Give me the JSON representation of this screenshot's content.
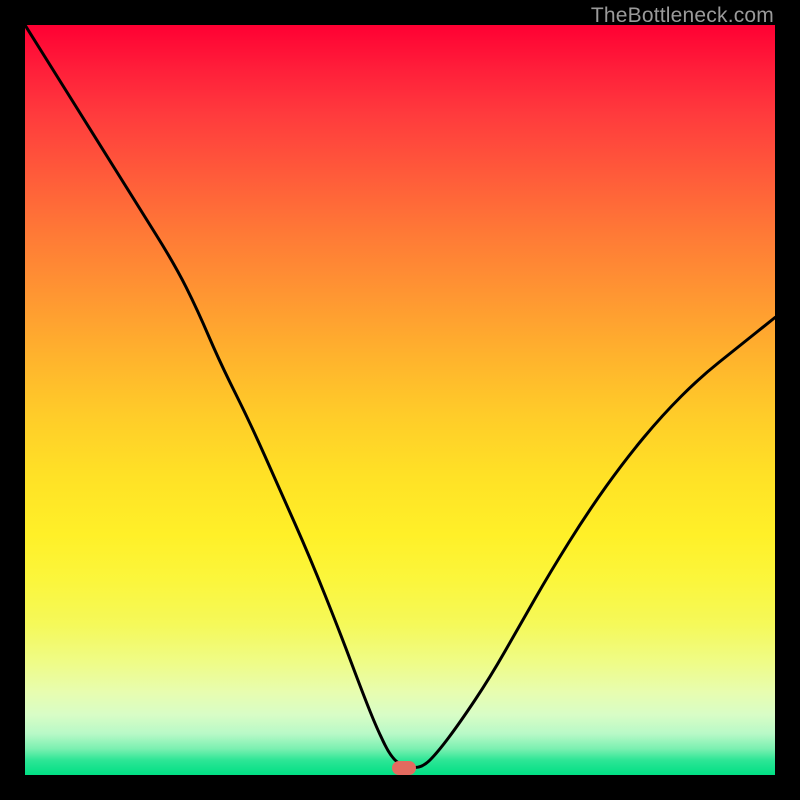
{
  "watermark": "TheBottleneck.com",
  "marker": {
    "x_pct": 50.5,
    "y_pct": 99.0
  },
  "chart_data": {
    "type": "line",
    "title": "",
    "xlabel": "",
    "ylabel": "",
    "xlim": [
      0,
      100
    ],
    "ylim": [
      0,
      100
    ],
    "grid": false,
    "legend": false,
    "series": [
      {
        "name": "bottleneck-curve",
        "x": [
          0,
          5,
          10,
          15,
          20,
          23,
          26,
          30,
          34,
          38,
          42,
          45,
          47,
          49,
          51,
          53,
          55,
          58,
          62,
          66,
          70,
          75,
          80,
          85,
          90,
          95,
          100
        ],
        "y": [
          100,
          92,
          84,
          76,
          68,
          62,
          55,
          47,
          38,
          29,
          19,
          11,
          6,
          2,
          1,
          1,
          3,
          7,
          13,
          20,
          27,
          35,
          42,
          48,
          53,
          57,
          61
        ]
      }
    ],
    "marker_point": {
      "x": 50.5,
      "y": 1
    },
    "background_gradient": {
      "top": "#ff0033",
      "mid": "#ffe126",
      "bottom": "#00df84"
    }
  }
}
